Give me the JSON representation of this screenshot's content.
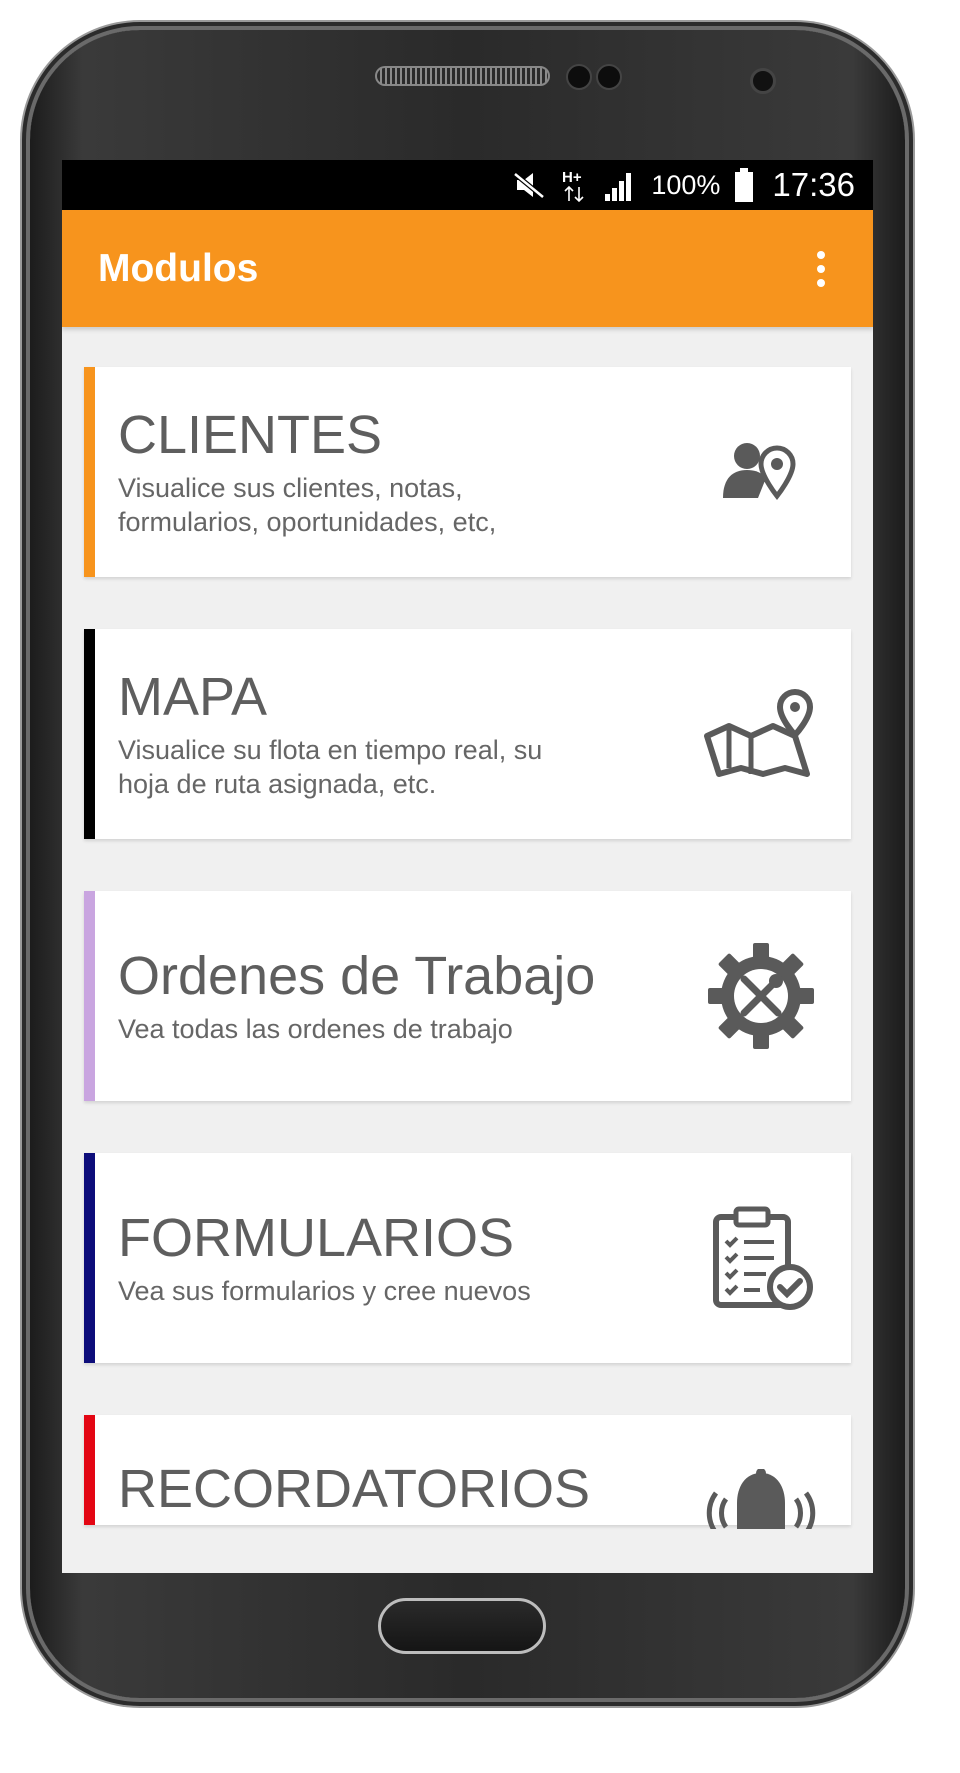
{
  "status_bar": {
    "icons": [
      "mute-icon",
      "hplus-data-icon",
      "signal-icon",
      "battery-icon"
    ],
    "network_label": "H+",
    "battery_percent": "100%",
    "time": "17:36"
  },
  "app_bar": {
    "title": "Modulos",
    "menu_icon": "more-vert-icon"
  },
  "modules": [
    {
      "title": "CLIENTES",
      "description": "Visualice sus clientes, notas, formularios, oportunidades, etc,",
      "accent_color": "#f7941d",
      "icon": "client-location-icon"
    },
    {
      "title": "MAPA",
      "description": "Visualice su flota en tiempo real, su hoja de ruta asignada, etc.",
      "accent_color": "#000000",
      "icon": "map-pin-icon"
    },
    {
      "title": "Ordenes de Trabajo",
      "description": "Vea todas las ordenes de trabajo",
      "accent_color": "#c9a5e0",
      "icon": "gear-tools-icon"
    },
    {
      "title": "FORMULARIOS",
      "description": "Vea sus formularios y cree nuevos",
      "accent_color": "#0d0d7a",
      "icon": "clipboard-check-icon"
    },
    {
      "title": "RECORDATORIOS",
      "description": "",
      "accent_color": "#e30613",
      "icon": "bell-icon"
    }
  ],
  "colors": {
    "app_bar": "#f7941d",
    "screen_background": "#f0f0f0",
    "icon_gray": "#5a5a5a"
  }
}
